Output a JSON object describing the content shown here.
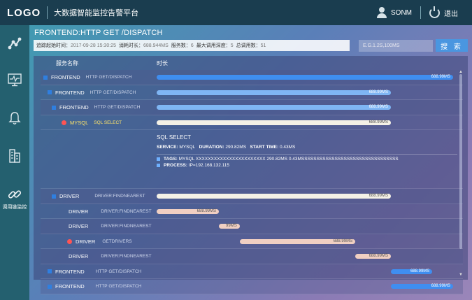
{
  "app": {
    "logo": "LOGO",
    "title": "大数据智能监控告警平台",
    "user_name": "SONM",
    "logout_label": "退出"
  },
  "sidebar": {
    "items": [
      {
        "icon": "topology-icon",
        "label": ""
      },
      {
        "icon": "monitor-icon",
        "label": ""
      },
      {
        "icon": "bell-icon",
        "label": ""
      },
      {
        "icon": "building-icon",
        "label": ""
      },
      {
        "icon": "link-icon",
        "label": "调用链监控"
      }
    ]
  },
  "header": {
    "page_title": "FRONTEND:HTTP GET /DISPATCH",
    "info": {
      "start_time_label": "追踪起始时间：",
      "start_time_value": "2017-09-28 15:30:25",
      "duration_label": "消耗时长：",
      "duration_value": "688.944MS",
      "service_count_label": "服务数：",
      "service_count_value": "6",
      "max_depth_label": "最大调用深度：",
      "max_depth_value": "5",
      "total_calls_label": "总调用数：",
      "total_calls_value": "51"
    },
    "search": {
      "placeholder": "E.G.1.2S,100MS",
      "button_label": "搜 索"
    }
  },
  "table": {
    "col_service": "服务名称",
    "col_duration": "时长",
    "rows": [
      {
        "name": "FRONTEND",
        "detail": "HTTP GET/DISPATCH",
        "bar_label": "688.99MS",
        "bar_start": 0.0,
        "bar_end": 1.0,
        "bar_color": "#3f8ef0"
      },
      {
        "name": "FRONTEND",
        "detail": "HTTP GET/DISPATCH",
        "bar_label": "688.99MS",
        "bar_start": 0.0,
        "bar_end": 0.79,
        "bar_color": "#7fb6f4"
      },
      {
        "name": "FRONTEND",
        "detail": "HTTP GET/DISPATCH",
        "bar_label": "688.99MS",
        "bar_start": 0.0,
        "bar_end": 0.79,
        "bar_color": "#7fb6f4"
      },
      {
        "name": "MYSQL",
        "detail": "SQL SELECT",
        "bar_label": "688.99MS",
        "bar_start": 0.0,
        "bar_end": 0.79,
        "bar_color": "#f4f1e6"
      },
      {
        "name": "DRIVER",
        "detail": "DRIVER:FINDNEAREST",
        "bar_label": "688.99MS",
        "bar_start": 0.0,
        "bar_end": 0.79,
        "bar_color": "#f4f1e6"
      },
      {
        "name": "DRIVER",
        "detail": "DRIVER:FINDNEAREST",
        "bar_label": "688.99MS",
        "bar_start": 0.0,
        "bar_end": 0.21,
        "bar_color": "#f0cfc2"
      },
      {
        "name": "DRIVER",
        "detail": "DRIVER:FINDNEAREST",
        "bar_label": "99MS",
        "bar_start": 0.21,
        "bar_end": 0.28,
        "bar_color": "#f0cfc2"
      },
      {
        "name": "DRIVER",
        "detail": "GETDRIVERS",
        "bar_label": "688.99MS",
        "bar_start": 0.28,
        "bar_end": 0.67,
        "bar_color": "#f0cfc2"
      },
      {
        "name": "DRIVER",
        "detail": "DRIVER:FINDNEAREST",
        "bar_label": "688.99MS",
        "bar_start": 0.67,
        "bar_end": 0.79,
        "bar_color": "#f0cfc2"
      },
      {
        "name": "FRONTEND",
        "detail": "HTTP GET/DISPATCH",
        "bar_label": "688.99MS",
        "bar_start": 0.79,
        "bar_end": 0.93,
        "bar_color": "#3f8ef0"
      },
      {
        "name": "FRONTEND",
        "detail": "HTTP GET/DISPATCH",
        "bar_label": "688.99MS",
        "bar_start": 0.79,
        "bar_end": 1.0,
        "bar_color": "#3f8ef0"
      }
    ],
    "sql_detail": {
      "title": "SQL SELECT",
      "service_label": "SERVICE:",
      "service_value": "MYSQL",
      "duration_label": "DURATION:",
      "duration_value": "290.82MS",
      "start_label": "START TIME:",
      "start_value": "0.43MS",
      "tags_label": "TAGS:",
      "tags_value": "MYSQL   XXXXXXXXXXXXXXXXXXXXXXX   290.82MS   0.43MSSSSSSSSSSSSSSSSSSSSSSSSSSSSSSSS",
      "process_label": "PROCESS:",
      "process_value": "IP=192.168.132.115"
    }
  }
}
